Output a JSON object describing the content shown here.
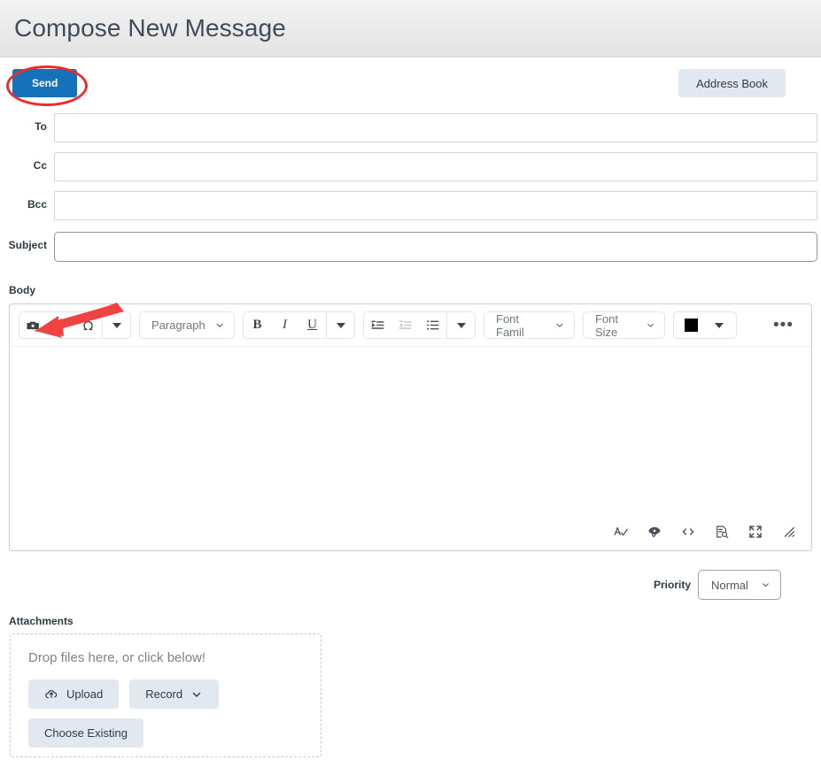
{
  "header": {
    "title": "Compose New Message"
  },
  "action_bar": {
    "send_label": "Send",
    "address_book_label": "Address Book"
  },
  "form": {
    "fields": [
      {
        "label": "To",
        "value": "",
        "placeholder": ""
      },
      {
        "label": "Cc",
        "value": "",
        "placeholder": ""
      },
      {
        "label": "Bcc",
        "value": "",
        "placeholder": ""
      },
      {
        "label": "Subject",
        "value": "",
        "placeholder": ""
      }
    ],
    "body_label": "Body"
  },
  "editor": {
    "toolbar": {
      "insert_image_icon": "camera-icon",
      "link_icon": "link-icon",
      "special_char_icon": "omega-icon",
      "insert_more_icon": "chevron-down-icon",
      "paragraph_select": "Paragraph",
      "bold_icon": "bold-icon",
      "italic_icon": "italic-icon",
      "underline_icon": "underline-icon",
      "format_more_icon": "chevron-down-icon",
      "indent_icon": "indent-icon",
      "outdent_icon": "outdent-icon",
      "bullet_list_icon": "bullet-list-icon",
      "list_more_icon": "chevron-down-icon",
      "font_family_select": "Font Famil",
      "font_size_select": "Font Size",
      "text_color_swatch": "#000000",
      "text_color_more_icon": "chevron-down-icon",
      "overflow_label": "•••"
    },
    "content": "",
    "footer_icons": [
      "spellcheck-icon",
      "accessibility-checker-icon",
      "html-source-icon",
      "word-count-icon",
      "fullscreen-icon",
      "resize-handle-icon"
    ]
  },
  "priority": {
    "label": "Priority",
    "value": "Normal"
  },
  "attachments": {
    "label": "Attachments",
    "dropzone_text": "Drop files here, or click below!",
    "upload_label": "Upload",
    "record_label": "Record",
    "choose_existing_label": "Choose Existing"
  },
  "annotations": {
    "ellipse_color": "#ee2b2b",
    "arrow_color": "#f04242"
  }
}
